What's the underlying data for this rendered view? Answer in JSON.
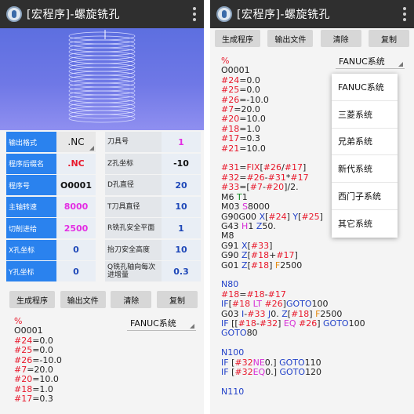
{
  "app": {
    "title": "[宏程序]-螺旋铣孔"
  },
  "buttons": {
    "generate": "生成程序",
    "export": "输出文件",
    "clear": "清除",
    "copy": "复制"
  },
  "left": {
    "rows": [
      {
        "label": "输出格式",
        "value": ".NC",
        "label2": "刀具号",
        "value2": "1"
      },
      {
        "label": "程序后缀名",
        "value": ".NC",
        "label2": "Z孔坐标",
        "value2": "-10"
      },
      {
        "label": "程序号",
        "value": "O0001",
        "label2": "D孔直径",
        "value2": "20"
      },
      {
        "label": "主轴转速",
        "value": "8000",
        "label2": "T刀具直径",
        "value2": "10"
      },
      {
        "label": "切削进给",
        "value": "2500",
        "label2": "R铣孔安全平面",
        "value2": "1"
      },
      {
        "label": "X孔坐标",
        "value": "0",
        "label2": "抬刀安全高度",
        "value2": "10"
      },
      {
        "label": "Y孔坐标",
        "value": "0",
        "label2": "Q铣孔轴向每次进增量",
        "value2": "0.3"
      }
    ],
    "system_selected": "FANUC系统",
    "code_lines": [
      "%",
      "O0001",
      "#24=0.0",
      "#25=0.0",
      "#26=-10.0",
      "#7=20.0",
      "#20=10.0",
      "#18=1.0",
      "#17=0.3"
    ]
  },
  "right": {
    "system_selected": "FANUC系统",
    "dropdown_options": [
      "FANUC系统",
      "三菱系统",
      "兄弟系统",
      "新代系统",
      "西门子系统",
      "其它系统"
    ],
    "code_lines": [
      "%",
      "O0001",
      "#24=0.0",
      "#25=0.0",
      "#26=-10.0",
      "#7=20.0",
      "#20=10.0",
      "#18=1.0",
      "#17=0.3",
      "#21=10.0",
      "",
      "#31=FIX[#26/#17]",
      "#32=#26-#31*#17",
      "#33=[#7-#20]/2.",
      "M6 T1",
      "M03 S8000",
      "G90G00 X[#24] Y[#25]",
      "G43 H1 Z50.",
      "M8",
      "G91 X[#33]",
      "G90 Z[#18+#17]",
      "G01 Z[#18] F2500",
      "",
      "N80",
      "#18=#18-#17",
      "IF[#18 LT #26]GOTO100",
      "G03 I-#33 J0. Z[#18] F2500",
      "IF [[#18-#32] EQ #26] GOTO100",
      "GOTO80",
      "",
      "N100",
      "IF [#32NE0.] GOTO110",
      "IF [#32EQ0.] GOTO120",
      "",
      "N110"
    ]
  },
  "colors": {
    "toolbar": "#2f2f2f",
    "label_blue": "#2a82ee",
    "value_blue": "#1f48b8",
    "value_red": "#e8182b",
    "value_magenta": "#e32ee3"
  }
}
